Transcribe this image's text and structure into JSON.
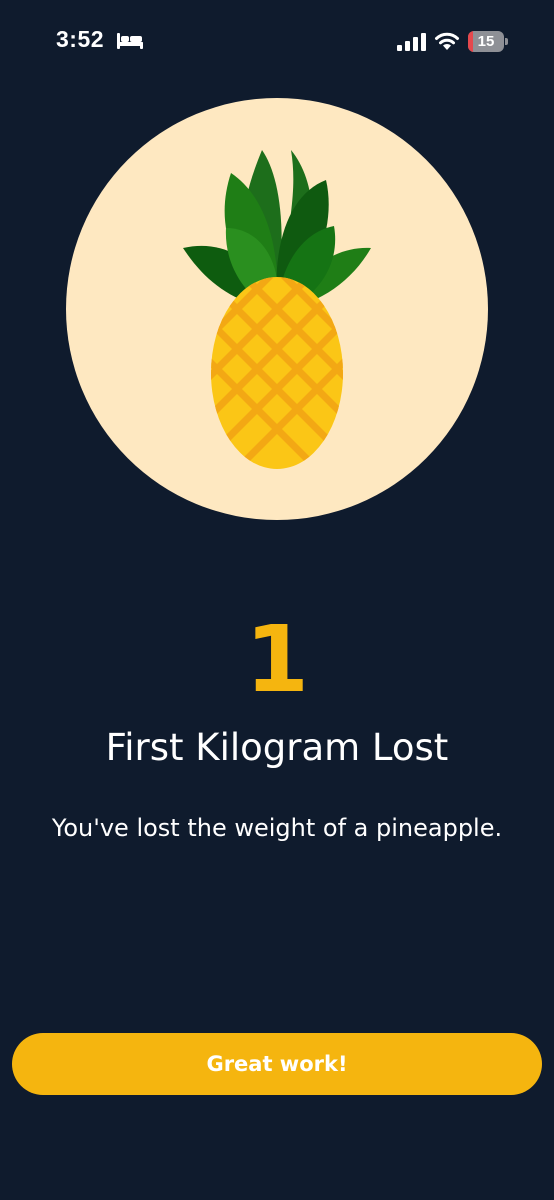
{
  "status_bar": {
    "time": "3:52",
    "focus_icon": "bed-icon",
    "signal_icon": "cellular-signal-icon",
    "wifi_icon": "wifi-icon",
    "battery_level": "15",
    "battery_fraction": 0.15,
    "battery_low_color": "#e5484d"
  },
  "illustration": {
    "icon": "pineapple-icon",
    "background_color": "#fee8c1"
  },
  "milestone": {
    "number": "1",
    "title": "First Kilogram Lost",
    "message": "You've lost the weight of a pineapple."
  },
  "actions": {
    "primary_label": "Great work!"
  },
  "colors": {
    "background": "#0f1b2d",
    "accent": "#f5b50f",
    "text": "#ffffff"
  }
}
